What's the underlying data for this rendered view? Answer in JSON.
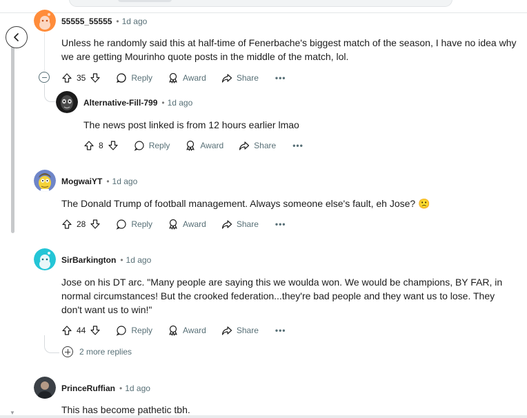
{
  "comments": [
    {
      "username": "55555_55555",
      "time": "1d ago",
      "text_lines": [
        "Unless he randomly said this at half-time of Fenerbache's biggest match of the season, I have no idea why",
        "we are getting Mourinho quote posts in the middle of the match, lol."
      ],
      "votes": "35",
      "avatar": "snoo-orange-avatar"
    },
    {
      "username": "Alternative-Fill-799",
      "time": "1d ago",
      "text_lines": [
        "The news post linked is from 12 hours earlier lmao"
      ],
      "votes": "8",
      "avatar": "dark-figure-avatar"
    },
    {
      "username": "MogwaiYT",
      "time": "1d ago",
      "text_lines": [
        "The Donald Trump of football management. Always someone else's fault, eh Jose? 🙁"
      ],
      "votes": "28",
      "avatar": "cartoon-man-avatar"
    },
    {
      "username": "SirBarkington",
      "time": "1d ago",
      "text_lines": [
        "Jose on his DT arc. \"Many people are saying this we woulda won. We would be champions, BY FAR, in",
        "normal circumstances! But the crooked federation...they're bad people and they want us to lose. They",
        "don't want us to win!\""
      ],
      "votes": "44",
      "avatar": "snoo-teal-avatar"
    },
    {
      "username": "PrinceRuffian",
      "time": "1d ago",
      "text_lines": [
        "This has become pathetic tbh."
      ],
      "avatar": "photo-avatar"
    }
  ],
  "actions": {
    "reply": "Reply",
    "award": "Award",
    "share": "Share",
    "more": "•••"
  },
  "separator": "•",
  "more_replies": "2 more replies",
  "icons": [
    "back-arrow-icon",
    "upvote-icon",
    "downvote-icon",
    "reply-icon",
    "award-icon",
    "share-icon",
    "collapse-icon",
    "expand-icon"
  ],
  "colors": {
    "meta": "#576f76",
    "text": "#1c1c1c",
    "thread": "#e5e8ea",
    "snoo_orange": "#ff8c3a",
    "snoo_teal": "#24c5d6"
  }
}
